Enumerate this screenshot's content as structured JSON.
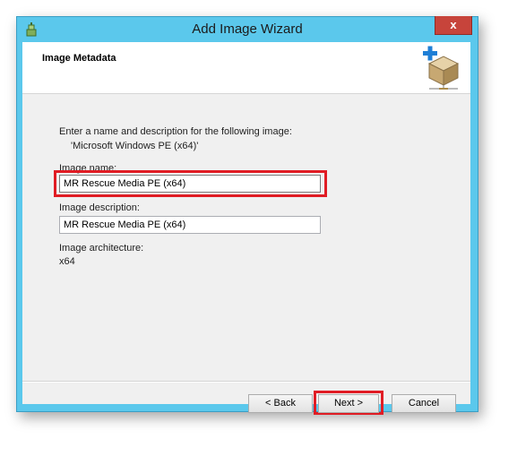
{
  "window": {
    "title": "Add Image Wizard",
    "close_label": "x",
    "accent_color": "#5bc8ec",
    "icon": "wizard-app-icon"
  },
  "header": {
    "title": "Image Metadata",
    "icon": "add-image-icon"
  },
  "content": {
    "intro_line1": "Enter a name and description for the following image:",
    "intro_line2": "'Microsoft Windows PE (x64)'",
    "image_name_label": "Image name:",
    "image_name_value": "MR Rescue Media PE (x64)",
    "image_description_label": "Image description:",
    "image_description_value": "MR Rescue Media PE (x64)",
    "architecture_label": "Image architecture:",
    "architecture_value": "x64"
  },
  "buttons": {
    "back": "< Back",
    "next": "Next >",
    "cancel": "Cancel"
  },
  "highlight_color": "#e01c24"
}
